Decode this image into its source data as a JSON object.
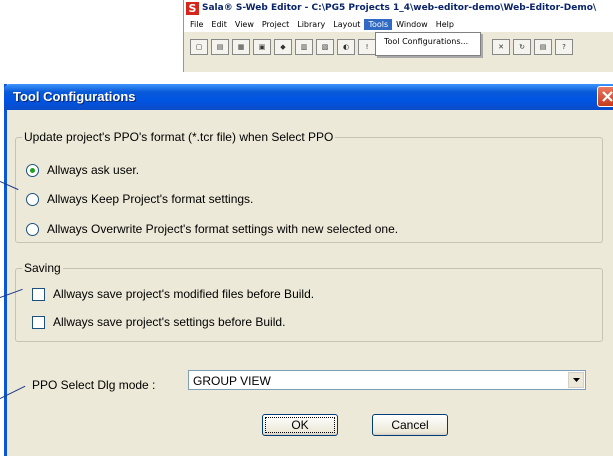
{
  "app": {
    "title": "Sala® S-Web Editor - C:\\PG5 Projects 1_4\\web-editor-demo\\Web-Editor-Demo\\",
    "logo": "S",
    "menu": [
      "File",
      "Edit",
      "View",
      "Project",
      "Library",
      "Layout",
      "Tools",
      "Window",
      "Help"
    ],
    "active_menu": "Tools",
    "tools_menu_item": "Tool Configurations..."
  },
  "dialog": {
    "title": "Tool Configurations",
    "ppo_group": {
      "label": "Update project's PPO's format (*.tcr file)  when Select PPO",
      "options": [
        {
          "label": "Allways ask user.",
          "checked": true
        },
        {
          "label": "Allways Keep Project's format settings.",
          "checked": false
        },
        {
          "label": "Allways Overwrite Project's format settings with new selected one.",
          "checked": false
        }
      ]
    },
    "saving_group": {
      "label": "Saving",
      "options": [
        {
          "label": "Allways save project's modified files before Build.",
          "checked": false
        },
        {
          "label": "Allways save project's settings before Build.",
          "checked": false
        }
      ]
    },
    "ppo_select": {
      "label": "PPO Select Dlg mode :",
      "value": "GROUP VIEW"
    },
    "ok_label": "OK",
    "cancel_label": "Cancel"
  },
  "colors": {
    "titlebar": "#0054e3",
    "dialog_bg": "#ece9d8",
    "close": "#c7391c"
  }
}
